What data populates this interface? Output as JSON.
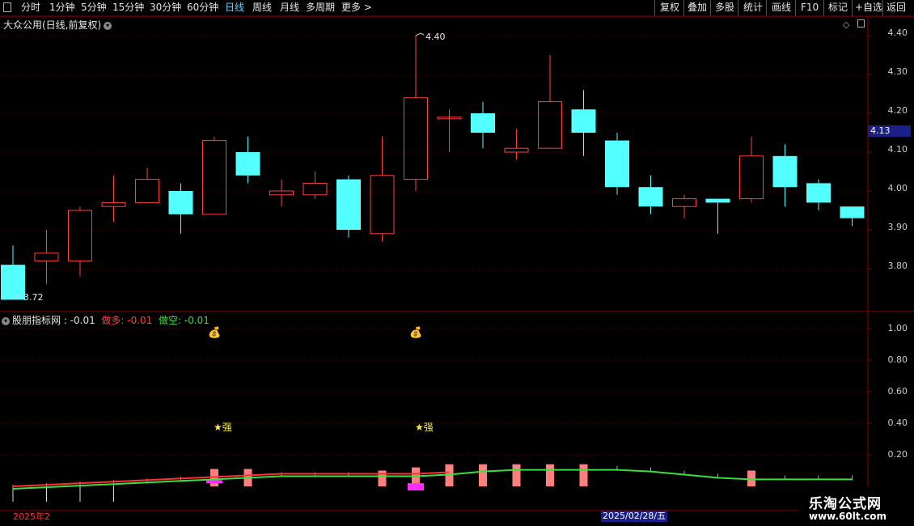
{
  "toolbar": {
    "left": [
      "分时",
      "1分钟",
      "5分钟",
      "15分钟",
      "30分钟",
      "60分钟",
      "日线",
      "周线",
      "月线",
      "多周期",
      "更多 >"
    ],
    "active_index": 6,
    "right": [
      "复权",
      "叠加",
      "多股",
      "统计",
      "画线",
      "F10",
      "标记",
      "+自选",
      "返回"
    ]
  },
  "main": {
    "title": "大众公用(日线,前复权)",
    "current_price": "4.13",
    "high_label": "4.40",
    "low_label": "3.72",
    "y_ticks": [
      "4.40",
      "4.30",
      "4.20",
      "4.10",
      "4.00",
      "3.90",
      "3.80"
    ]
  },
  "indicator": {
    "name": "股朋指标网 ",
    "value": ": -0.01",
    "up_label": "做多: -0.01",
    "down_label": "做空: -0.01",
    "y_ticks": [
      "1.00",
      "0.80",
      "0.60",
      "0.40",
      "0.20"
    ],
    "strong_label": "★强"
  },
  "dates": {
    "start": "2025年2",
    "cursor": "2025/02/28/五"
  },
  "logo": {
    "name": "乐淘公式网",
    "url": "www.60lt.com"
  },
  "colors": {
    "up": "#ff4040",
    "down": "#54ffff",
    "green": "#3adf3a",
    "magenta": "#ff2bff",
    "pink": "#ff7f7f",
    "grid": "#5a0000"
  },
  "candles": [
    {
      "o": 3.81,
      "h": 3.86,
      "l": 3.72,
      "c": 3.72
    },
    {
      "o": 3.82,
      "h": 3.9,
      "l": 3.76,
      "c": 3.84
    },
    {
      "o": 3.82,
      "h": 3.96,
      "l": 3.78,
      "c": 3.95
    },
    {
      "o": 3.96,
      "h": 4.04,
      "l": 3.92,
      "c": 3.97
    },
    {
      "o": 3.97,
      "h": 4.06,
      "l": 3.97,
      "c": 4.03
    },
    {
      "o": 4.0,
      "h": 4.02,
      "l": 3.89,
      "c": 3.94
    },
    {
      "o": 3.94,
      "h": 4.14,
      "l": 3.94,
      "c": 4.13
    },
    {
      "o": 4.1,
      "h": 4.14,
      "l": 4.02,
      "c": 4.04
    },
    {
      "o": 3.99,
      "h": 4.03,
      "l": 3.96,
      "c": 4.0
    },
    {
      "o": 3.99,
      "h": 4.05,
      "l": 3.98,
      "c": 4.02
    },
    {
      "o": 4.03,
      "h": 4.04,
      "l": 3.88,
      "c": 3.9
    },
    {
      "o": 3.89,
      "h": 4.14,
      "l": 3.87,
      "c": 4.04
    },
    {
      "o": 4.03,
      "h": 4.4,
      "l": 4.0,
      "c": 4.24
    },
    {
      "o": 4.19,
      "h": 4.21,
      "l": 4.1,
      "c": 4.19
    },
    {
      "o": 4.2,
      "h": 4.23,
      "l": 4.11,
      "c": 4.15
    },
    {
      "o": 4.1,
      "h": 4.16,
      "l": 4.08,
      "c": 4.11
    },
    {
      "o": 4.11,
      "h": 4.35,
      "l": 4.11,
      "c": 4.23
    },
    {
      "o": 4.21,
      "h": 4.26,
      "l": 4.09,
      "c": 4.15
    },
    {
      "o": 4.13,
      "h": 4.15,
      "l": 3.99,
      "c": 4.01
    },
    {
      "o": 4.01,
      "h": 4.04,
      "l": 3.94,
      "c": 3.96
    },
    {
      "o": 3.96,
      "h": 3.99,
      "l": 3.93,
      "c": 3.98
    },
    {
      "o": 3.98,
      "h": 3.98,
      "l": 3.89,
      "c": 3.97
    },
    {
      "o": 3.98,
      "h": 4.14,
      "l": 3.97,
      "c": 4.09
    },
    {
      "o": 4.09,
      "h": 4.12,
      "l": 3.96,
      "c": 4.01
    },
    {
      "o": 4.02,
      "h": 4.03,
      "l": 3.95,
      "c": 3.97
    },
    {
      "o": 3.96,
      "h": 3.96,
      "l": 3.91,
      "c": 3.93
    }
  ],
  "indicator_series": {
    "line": [
      0.01,
      0.02,
      0.03,
      0.04,
      0.05,
      0.06,
      0.07,
      0.08,
      0.09,
      0.09,
      0.09,
      0.09,
      0.09,
      0.1,
      0.12,
      0.13,
      0.13,
      0.13,
      0.13,
      0.12,
      0.1,
      0.08,
      0.07,
      0.07,
      0.07,
      0.07
    ],
    "pink_bars": [
      0,
      0,
      0,
      0,
      0,
      0,
      0.11,
      0.11,
      0,
      0,
      0,
      0.1,
      0.12,
      0.14,
      0.14,
      0.14,
      0.14,
      0.14,
      0,
      0,
      0,
      0,
      0.1,
      0,
      0,
      0
    ],
    "magenta_bars": [
      0,
      0,
      0,
      0,
      0,
      0,
      0.01,
      0,
      0,
      0,
      0,
      0,
      -0.04,
      0,
      0,
      0,
      0,
      0,
      0,
      0,
      0,
      0,
      0,
      0,
      0,
      0
    ],
    "strong_at": [
      6,
      12
    ]
  }
}
